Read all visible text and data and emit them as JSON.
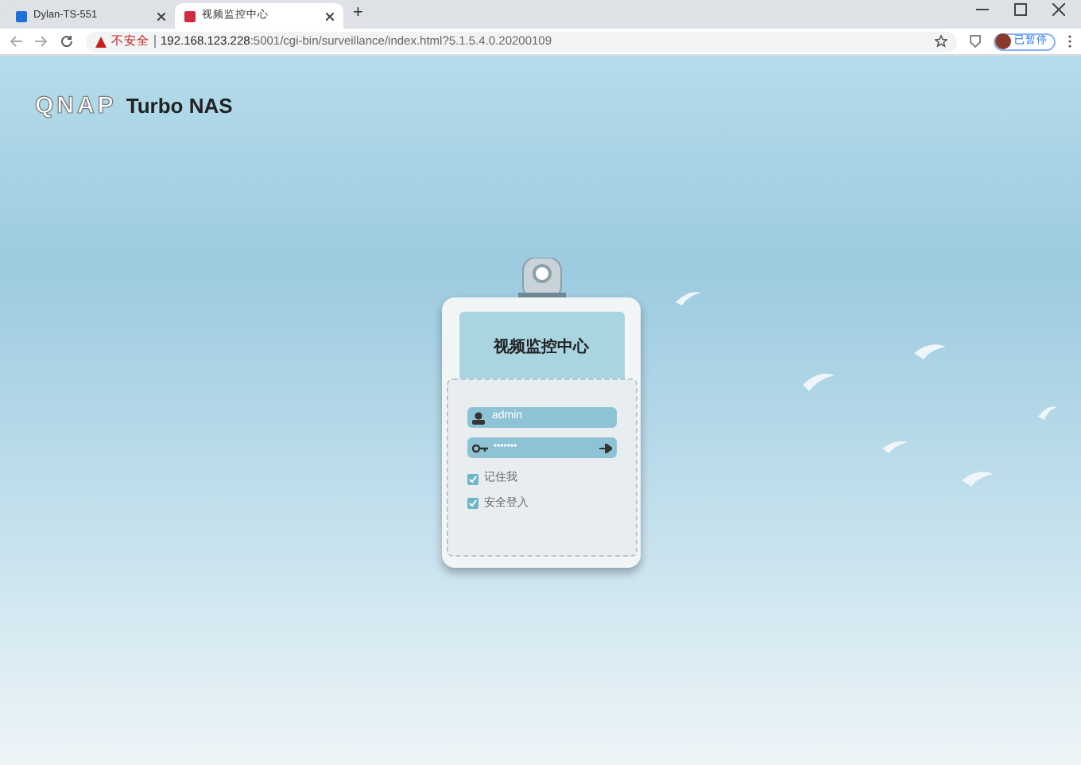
{
  "browser": {
    "tabs": [
      {
        "title": "Dylan-TS-551",
        "selected": false
      },
      {
        "title": "视频监控中心",
        "selected": true
      }
    ],
    "new_tab": "+",
    "address": {
      "security_label": "不安全",
      "host": "192.168.123.228",
      "path": ":5001/cgi-bin/surveillance/index.html?5.1.5.4.0.20200109"
    },
    "profile_label": "已暂停"
  },
  "header": {
    "logo": "QNAP",
    "product": "Turbo NAS"
  },
  "login_card": {
    "title": "视频监控中心",
    "username": {
      "value": "admin"
    },
    "password": {
      "value": "•••••••"
    },
    "options": [
      {
        "label": "记住我",
        "checked": true
      },
      {
        "label": "安全登入",
        "checked": true
      }
    ]
  }
}
